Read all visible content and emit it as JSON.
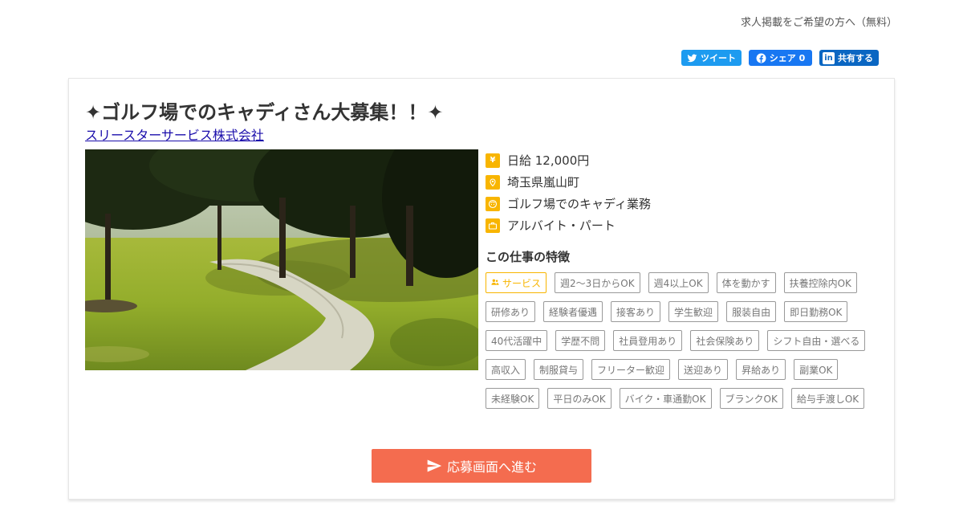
{
  "header": {
    "employer_link": "求人掲載をご希望の方へ（無料）"
  },
  "share": {
    "tweet": "ツイート",
    "facebook": "シェア 0",
    "linkedin": "共有する",
    "linkedin_badge": "in"
  },
  "job": {
    "title": "✦ゴルフ場でのキャディさん大募集！！✦",
    "company": "スリースターサービス株式会社",
    "salary": "日給 12,000円",
    "location": "埼玉県嵐山町",
    "description": "ゴルフ場でのキャディ業務",
    "employment_type": "アルバイト・パート",
    "salary_icon_glyph": "¥"
  },
  "features": {
    "heading": "この仕事の特徴",
    "highlight_tag": "サービス",
    "tags": [
      "週2～3日からOK",
      "週4以上OK",
      "体を動かす",
      "扶養控除内OK",
      "研修あり",
      "経験者優遇",
      "接客あり",
      "学生歓迎",
      "服装自由",
      "即日勤務OK",
      "40代活躍中",
      "学歴不問",
      "社員登用あり",
      "社会保険あり",
      "シフト自由・選べる",
      "高収入",
      "制服貸与",
      "フリーター歓迎",
      "送迎あり",
      "昇給あり",
      "副業OK",
      "未経験OK",
      "平日のみOK",
      "バイク・車通勤OK",
      "ブランクOK",
      "給与手渡しOK"
    ]
  },
  "apply": {
    "label": "応募画面へ進む"
  },
  "colors": {
    "accent": "#f8b500",
    "apply": "#f46c4f",
    "twitter": "#1d9bf0",
    "facebook": "#1877f2",
    "linkedin": "#0a66c2"
  }
}
